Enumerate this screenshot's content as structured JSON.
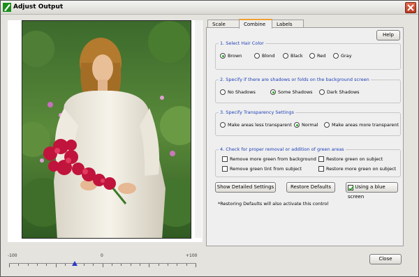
{
  "window": {
    "title": "Adjust Output"
  },
  "slider": {
    "min_label": "-100",
    "mid_label": "0",
    "max_label": "+100",
    "value": -30
  },
  "tabs": [
    {
      "label": "Scale",
      "active": false
    },
    {
      "label": "Combine",
      "active": true
    },
    {
      "label": "Labels",
      "active": false
    }
  ],
  "help_label": "Help",
  "section1": {
    "title": "1. Select Hair Color",
    "options": [
      "Brown",
      "Blond",
      "Black",
      "Red",
      "Gray"
    ],
    "selected": "Brown"
  },
  "section2": {
    "title": "2. Specify if there are shadows or folds on the background screen",
    "options": [
      "No Shadows",
      "Some Shadows",
      "Dark Shadows"
    ],
    "selected": "Some Shadows"
  },
  "section3": {
    "title": "3. Specify Transparency Settings",
    "options": [
      "Make areas less transparent",
      "Normal",
      "Make areas more transparent"
    ],
    "selected": "Normal"
  },
  "section4": {
    "title": "4. Check for proper removal or addition of green areas",
    "checks": [
      "Remove more green from background",
      "Restore green on subject",
      "Remove green tint from subject",
      "Restore more green on subject"
    ]
  },
  "buttons": {
    "detailed": "Show Detailed Settings",
    "restore": "Restore Defaults",
    "blue_screen": "Using a blue screen",
    "close": "Close"
  },
  "blue_screen_checked": true,
  "note": "*Restoring Defaults will also activate this control",
  "colors": {
    "accent": "#1d3fb6",
    "radio_on": "#22a822",
    "tab_highlight": "#f0a030"
  }
}
